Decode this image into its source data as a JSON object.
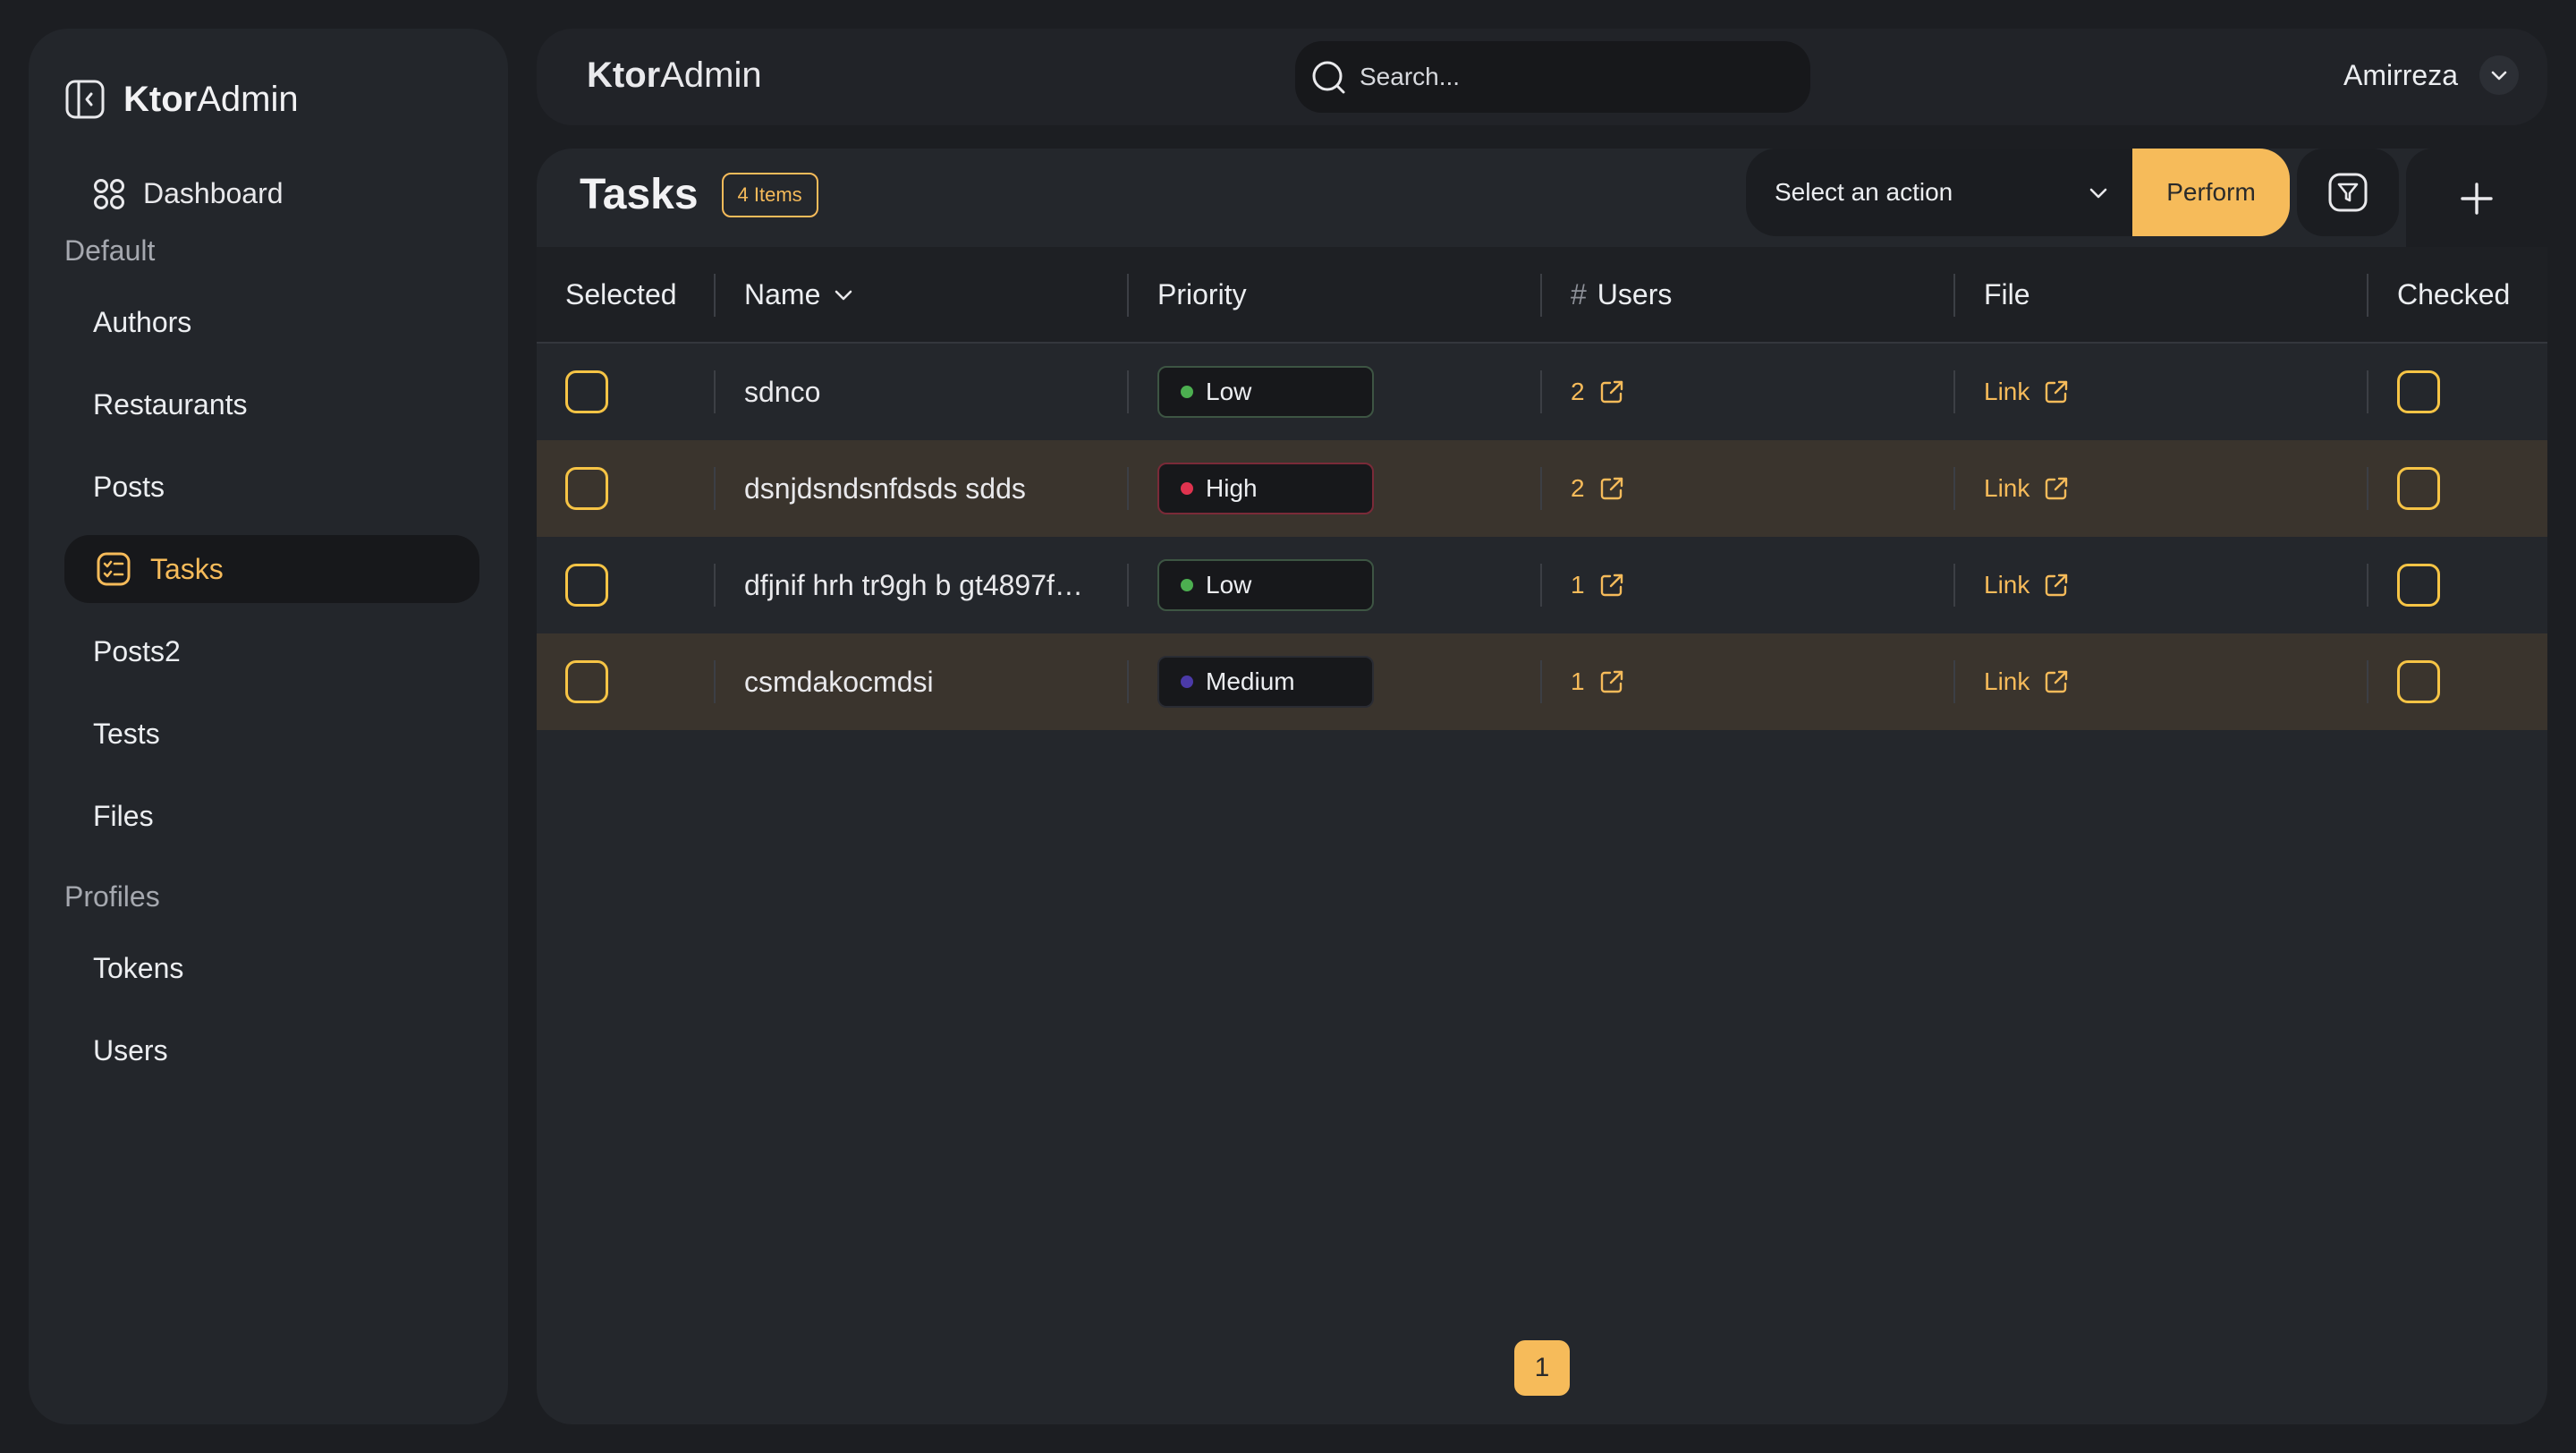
{
  "brand": {
    "bold": "Ktor",
    "light": "Admin"
  },
  "sidebar": {
    "dashboard": "Dashboard",
    "sections": [
      {
        "title": "Default",
        "items": [
          "Authors",
          "Restaurants",
          "Posts",
          "Tasks",
          "Posts2",
          "Tests",
          "Files"
        ]
      },
      {
        "title": "Profiles",
        "items": [
          "Tokens",
          "Users"
        ]
      }
    ],
    "active": "Tasks"
  },
  "header": {
    "title_bold": "Ktor",
    "title_light": "Admin",
    "search_placeholder": "Search...",
    "user": "Amirreza"
  },
  "main": {
    "title": "Tasks",
    "count_badge": "4 Items",
    "action_placeholder": "Select an action",
    "perform_label": "Perform",
    "columns": [
      "Selected",
      "Name",
      "Priority",
      "Users",
      "File",
      "Checked"
    ],
    "rows": [
      {
        "name": "sdnco",
        "priority": "Low",
        "priority_color": "#4caf50",
        "users": "2",
        "file": "Link"
      },
      {
        "name": "dsnjdsndsnfdsds sdds",
        "priority": "High",
        "priority_color": "#e0334f",
        "users": "2",
        "file": "Link"
      },
      {
        "name": "dfjnif hrh tr9gh b gt4897f…",
        "priority": "Low",
        "priority_color": "#4caf50",
        "users": "1",
        "file": "Link"
      },
      {
        "name": "csmdakocmdsi",
        "priority": "Medium",
        "priority_color": "#4b3aa8",
        "users": "1",
        "file": "Link"
      }
    ],
    "page": "1"
  },
  "colors": {
    "accent": "#f6bb5a",
    "bg": "#1c1e22",
    "panel": "#24272c"
  }
}
